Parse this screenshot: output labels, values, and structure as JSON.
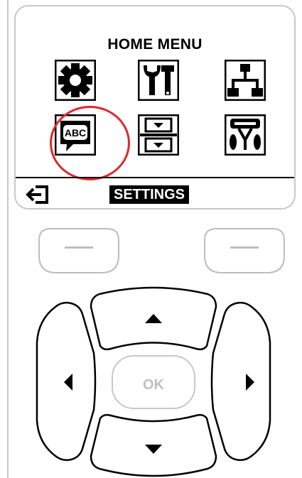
{
  "screen": {
    "title": "HOME MENU",
    "selected_label": "SETTINGS"
  },
  "menu_icons": [
    {
      "name": "gear-icon"
    },
    {
      "name": "tools-icon"
    },
    {
      "name": "network-icon"
    },
    {
      "name": "language-icon",
      "text": "ABC",
      "selected": true
    },
    {
      "name": "sensor-icon"
    },
    {
      "name": "ports-icon"
    }
  ],
  "navigation": {
    "ok_label": "OK",
    "arrows": [
      "up",
      "down",
      "left",
      "right"
    ]
  },
  "colors": {
    "selection_ring": "#e0282d",
    "button_outline": "#000000",
    "soft_button_outline": "#bdbdbd",
    "ok_text": "#bfbfbf"
  }
}
